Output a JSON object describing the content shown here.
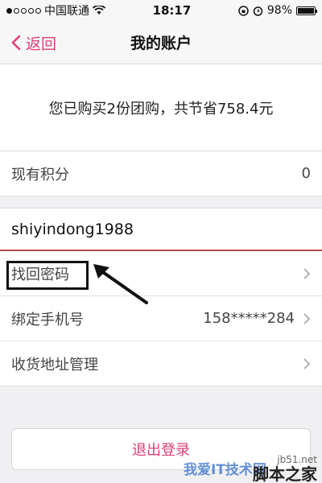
{
  "status": {
    "carrier": "中国联通",
    "time": "18:17",
    "battery": "98%",
    "battery_level": 0.98
  },
  "nav": {
    "back_label": "返回",
    "title": "我的账户"
  },
  "summary_text": "您已购买2份团购，共节省758.4元",
  "points": {
    "label": "现有积分",
    "value": "0"
  },
  "username": "shiyindong1988",
  "menu": [
    {
      "label": "找回密码",
      "value": ""
    },
    {
      "label": "绑定手机号",
      "value": "158*****284"
    },
    {
      "label": "收货地址管理",
      "value": ""
    }
  ],
  "logout_label": "退出登录",
  "watermark": {
    "overlay": "我爱IT技术网",
    "site": "jb51.net",
    "brand": "脚本之家"
  },
  "colors": {
    "accent": "#e23d7a",
    "underline": "#b94a4a"
  }
}
